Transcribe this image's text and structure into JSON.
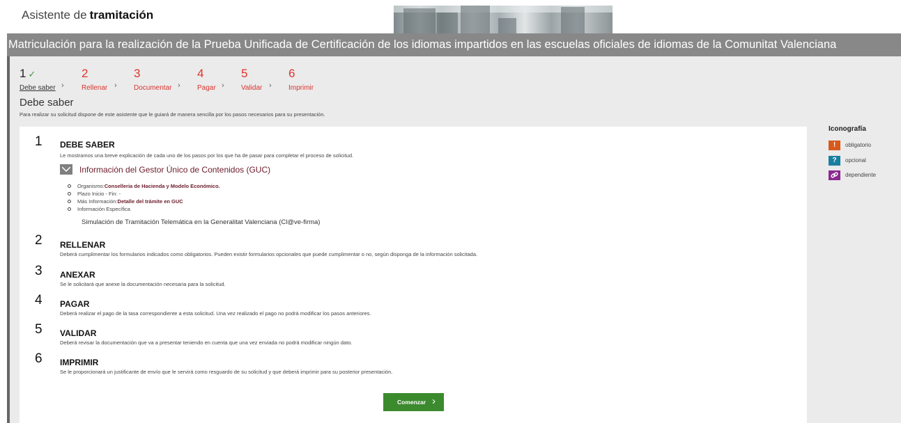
{
  "header": {
    "app_title_prefix": "Asistente de",
    "app_title_bold": "tramitación"
  },
  "procedure_title": "Matriculación para la realización de la Prueba Unificada de Certificación de los idiomas impartidos en las escuelas oficiales de idiomas de la Comunitat Valenciana",
  "steps": [
    {
      "number": "1",
      "label": "Debe saber",
      "completed": true
    },
    {
      "number": "2",
      "label": "Rellenar",
      "completed": false
    },
    {
      "number": "3",
      "label": "Documentar",
      "completed": false
    },
    {
      "number": "4",
      "label": "Pagar",
      "completed": false
    },
    {
      "number": "5",
      "label": "Validar",
      "completed": false
    },
    {
      "number": "6",
      "label": "Imprimir",
      "completed": false
    }
  ],
  "check_icon": "✓",
  "chevron_icon": "›",
  "section": {
    "title": "Debe saber",
    "description": "Para realizar su solicitud dispone de este asistente que le guiará de manera sencilla por los pasos necesarios para su presentación."
  },
  "blocks": [
    {
      "number": "1",
      "title": "DEBE SABER",
      "description": "Le mostramos una breve explicación de cada uno de los pasos por los que ha de pasar para completar el proceso de solicitud."
    },
    {
      "number": "2",
      "title": "RELLENAR",
      "description": "Deberá cumplimentar los formularios indicados como obligatorios. Pueden existir formularios opcionales que puede cumplimentar o no, según disponga de la información solicitada."
    },
    {
      "number": "3",
      "title": "ANEXAR",
      "description": "Se le solicitará que anexe la documentación necesaria para la solicitud."
    },
    {
      "number": "4",
      "title": "PAGAR",
      "description": "Deberá realizar el pago de la tasa correspondiente a esta solicitud. Una vez realizado el pago no podrá modificar los pasos anteriores."
    },
    {
      "number": "5",
      "title": "VALIDAR",
      "description": "Deberá revisar la documentación que va a presentar teniendo en cuenta que una vez enviada no podrá modificar ningún dato."
    },
    {
      "number": "6",
      "title": "IMPRIMIR",
      "description": "Se le proporcionará un justificante de envío que le servirá como resguardo de su solicitud y que deberá imprimir para su posterior presentación."
    }
  ],
  "guc": {
    "title": "Información del Gestor Único de Contenidos (GUC)",
    "organismo_label": "Organismo:",
    "organismo_value": "Conselleria de Hacienda y Modelo Económico.",
    "plazo": "Plazo Inicio - Fin: -",
    "mas_info_label": "Más Información:",
    "mas_info_link": "Detalle del trámite en GUC",
    "info_especifica": "Información Específica",
    "simulacion": "Simulación de Tramitación Telemática en la Generalitat Valenciana (Cl@ve-firma)"
  },
  "start_button": {
    "label": "Comenzar",
    "arrow": "›"
  },
  "legend": {
    "title": "Iconografía",
    "items": [
      {
        "symbol": "!",
        "label": "obligatorio",
        "color": "#d8591c"
      },
      {
        "symbol": "?",
        "label": "opcional",
        "color": "#1a7fa0"
      },
      {
        "symbol": "🔗",
        "label": "dependiente",
        "color": "#8a2a8f"
      }
    ]
  },
  "colors": {
    "accent_red": "#e0322b",
    "title_band": "#888888",
    "button_green": "#3c8a2e",
    "guc_text": "#6b1b2a"
  }
}
